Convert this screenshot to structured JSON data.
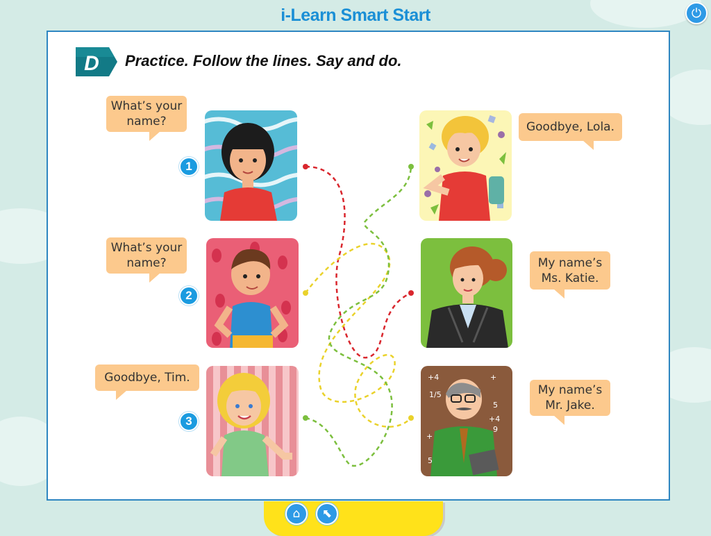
{
  "app": {
    "title": "i-Learn Smart Start"
  },
  "toolbar": {
    "power_icon": "power-icon"
  },
  "activity": {
    "badge": "D",
    "instruction": "Practice. Follow the lines. Say and do."
  },
  "left": [
    {
      "number": "1",
      "speech": [
        "What’s your",
        "name?"
      ],
      "picture": "girl-black-hair-red-dress"
    },
    {
      "number": "2",
      "speech": [
        "What’s your",
        "name?"
      ],
      "picture": "boy-blue-tank-top"
    },
    {
      "number": "3",
      "speech": [
        "Goodbye, Tim."
      ],
      "picture": "girl-blonde-green-top"
    }
  ],
  "right": [
    {
      "speech": [
        "Goodbye, Lola."
      ],
      "picture": "boy-blonde-backpack"
    },
    {
      "speech": [
        "My name’s",
        "Ms. Katie."
      ],
      "picture": "woman-teacher-blazer"
    },
    {
      "speech": [
        "My name’s",
        "Mr. Jake."
      ],
      "picture": "man-teacher-math-board"
    }
  ],
  "lines": {
    "colors": [
      "#d9262d",
      "#ead22b",
      "#7cbf3e"
    ]
  },
  "nav": {
    "home_icon": "home-icon",
    "back_icon": "arrow-back-icon"
  },
  "colors": {
    "accent": "#1a9be0",
    "bubble": "#fcc98d",
    "nav_bar": "#ffe21a"
  }
}
